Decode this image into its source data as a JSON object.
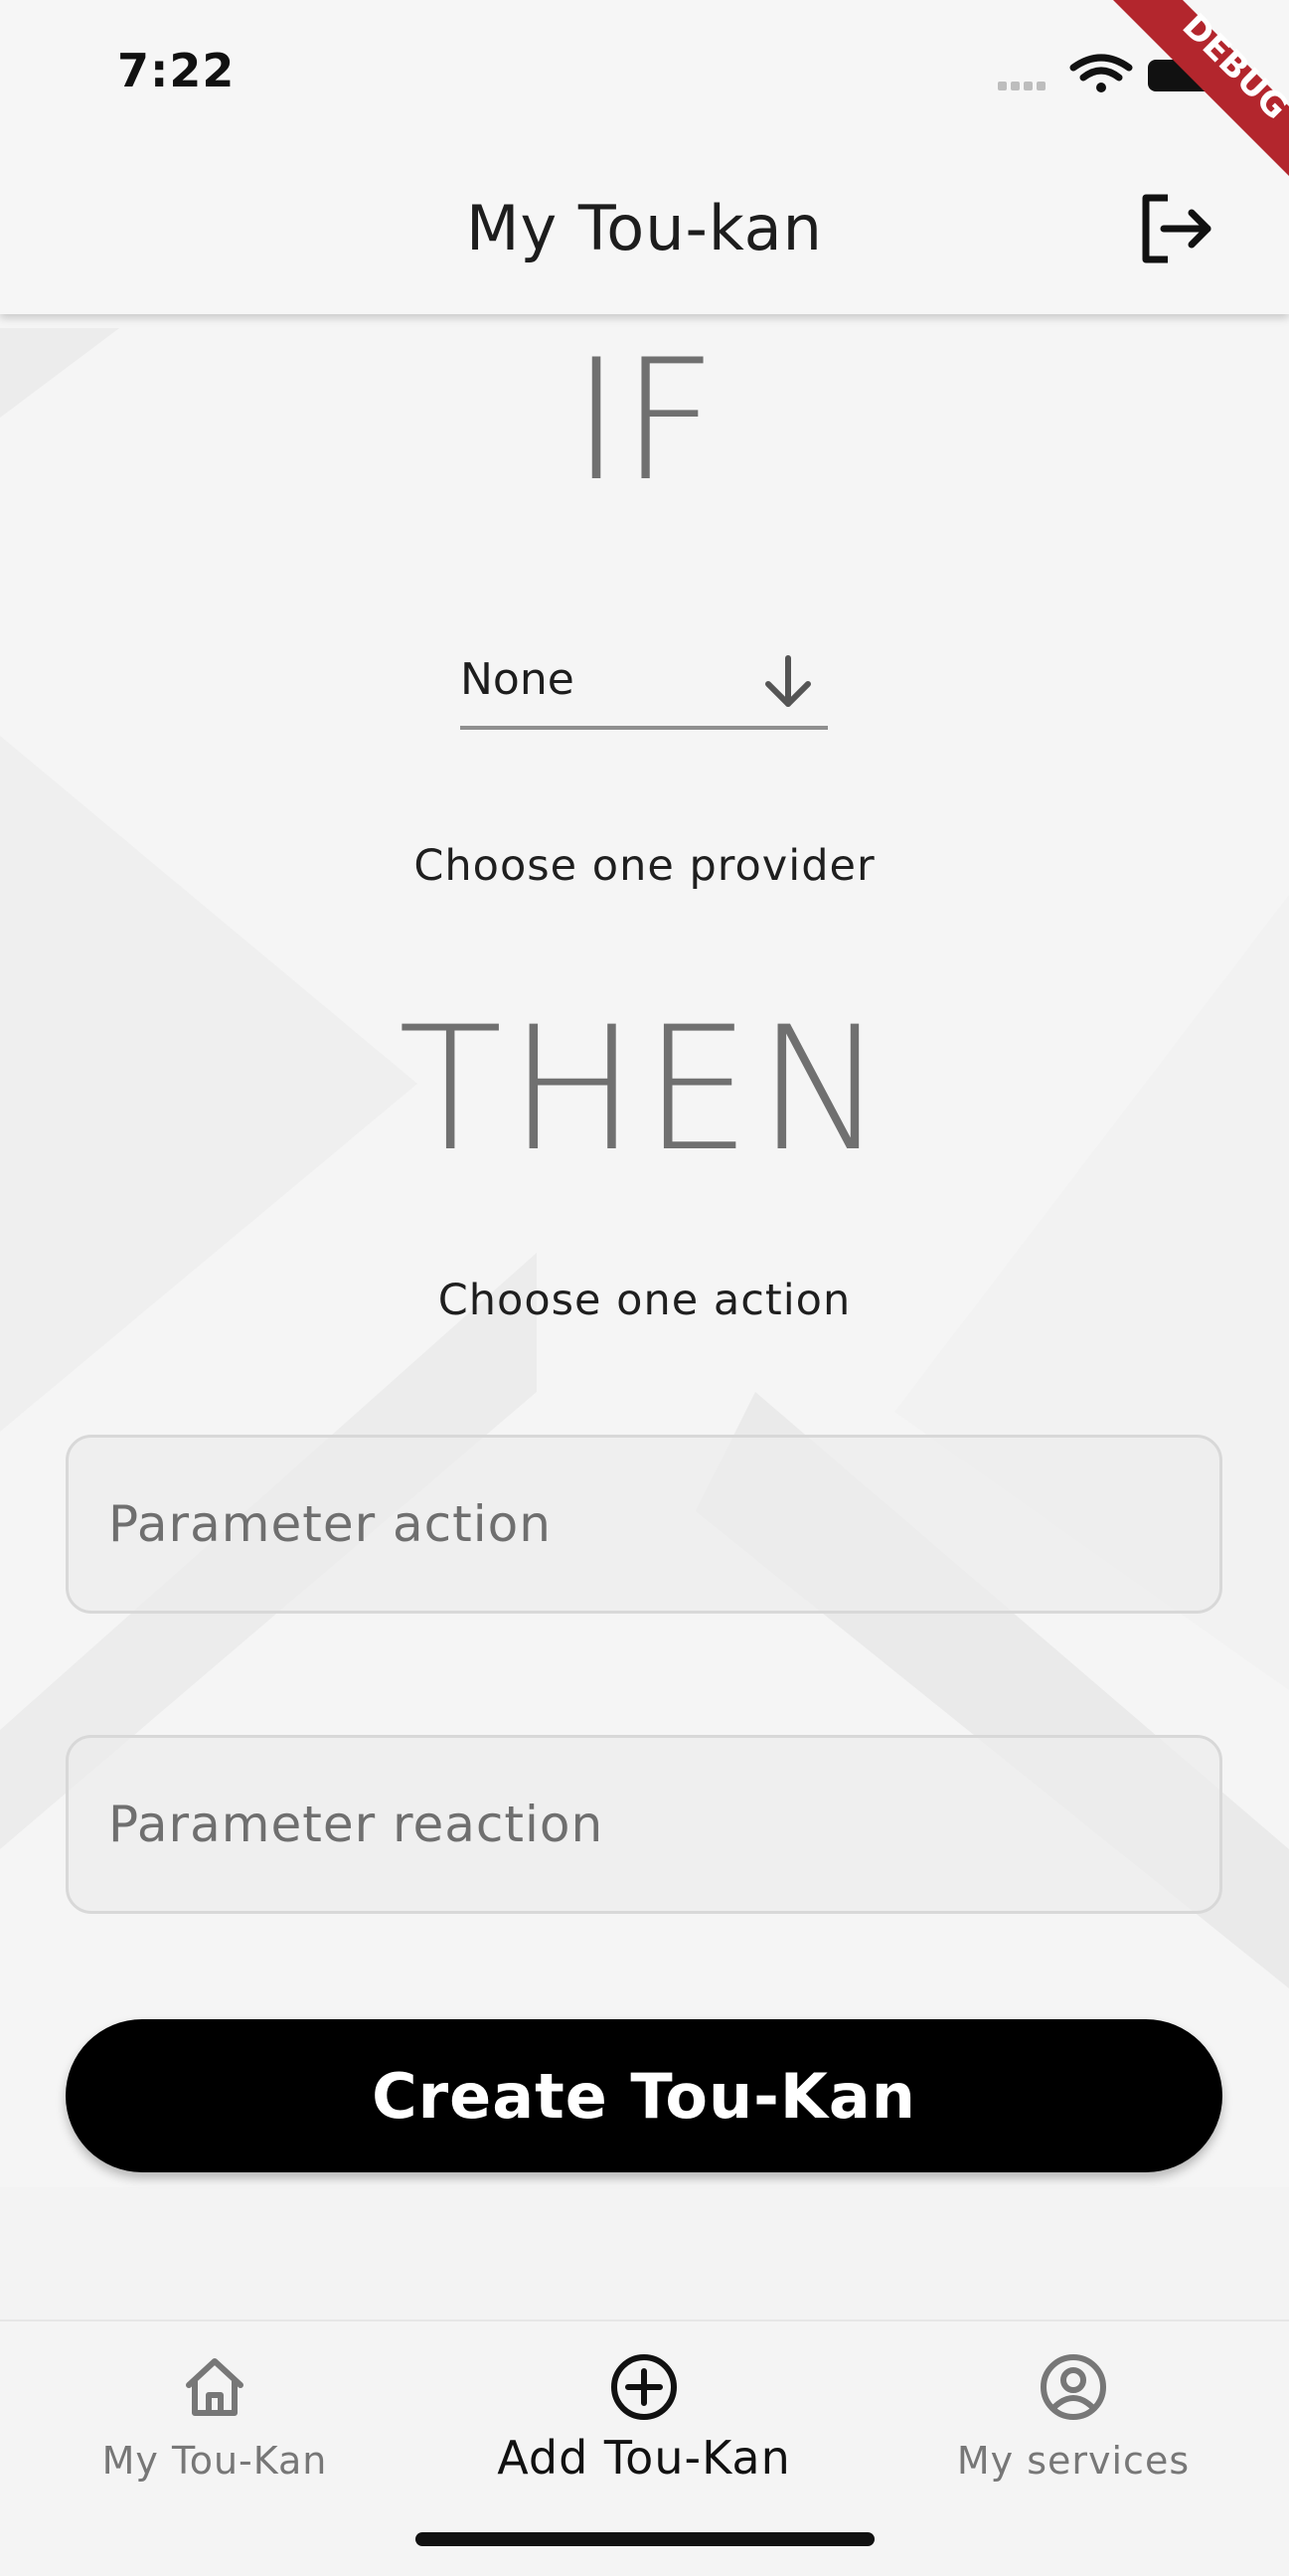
{
  "status_bar": {
    "time": "7:22"
  },
  "app_bar": {
    "title": "My Tou-kan",
    "logout_icon": "logout-icon"
  },
  "debug_banner": {
    "label": "DEBUG"
  },
  "form": {
    "if_label": "IF",
    "provider_dropdown": {
      "selected": "None",
      "icon": "arrow-down-icon"
    },
    "provider_hint": "Choose one provider",
    "then_label": "THEN",
    "action_hint": "Choose one action",
    "parameter_action": {
      "placeholder": "Parameter action",
      "value": ""
    },
    "parameter_reaction": {
      "placeholder": "Parameter reaction",
      "value": ""
    },
    "create_button": "Create Tou-Kan"
  },
  "bottom_nav": {
    "items": [
      {
        "label": "My Tou-Kan",
        "icon": "home-icon",
        "active": false
      },
      {
        "label": "Add Tou-Kan",
        "icon": "add-circle-icon",
        "active": true
      },
      {
        "label": "My services",
        "icon": "account-circle-icon",
        "active": false
      }
    ]
  },
  "colors": {
    "accent": "#000000",
    "heading_gray": "#707070",
    "debug_banner": "#b3262d"
  }
}
